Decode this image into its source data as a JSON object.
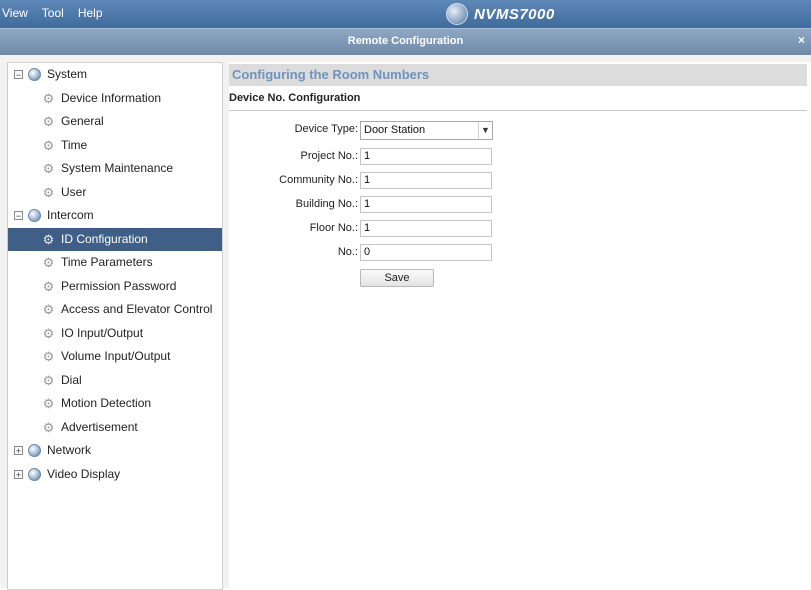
{
  "menu": [
    "View",
    "Tool",
    "Help"
  ],
  "app_name": "NVMS7000",
  "window": {
    "title": "Remote Configuration",
    "close_glyph": "×"
  },
  "tree": {
    "system": {
      "label": "System",
      "expander": "−",
      "children": [
        "Device Information",
        "General",
        "Time",
        "System Maintenance",
        "User"
      ]
    },
    "intercom": {
      "label": "Intercom",
      "expander": "−",
      "children": [
        "ID Configuration",
        "Time Parameters",
        "Permission Password",
        "Access and Elevator Control",
        "IO Input/Output",
        "Volume Input/Output",
        "Dial",
        "Motion Detection",
        "Advertisement"
      ],
      "selected": "ID Configuration"
    },
    "network": {
      "label": "Network",
      "expander": "+"
    },
    "video_display": {
      "label": "Video Display",
      "expander": "+"
    }
  },
  "panel": {
    "title": "Configuring the Room Numbers",
    "subtitle": "Device No. Configuration",
    "device_type": {
      "label": "Device Type:",
      "value": "Door Station"
    },
    "project_no": {
      "label": "Project No.:",
      "value": "1"
    },
    "community_no": {
      "label": "Community No.:",
      "value": "1"
    },
    "building_no": {
      "label": "Building No.:",
      "value": "1"
    },
    "floor_no": {
      "label": "Floor No.:",
      "value": "1"
    },
    "no": {
      "label": "No.:",
      "value": "0"
    },
    "save_label": "Save"
  },
  "colors": {
    "selection": "#3f5f86",
    "header_text": "#6f93bd",
    "topbar": "#4b78a8"
  }
}
